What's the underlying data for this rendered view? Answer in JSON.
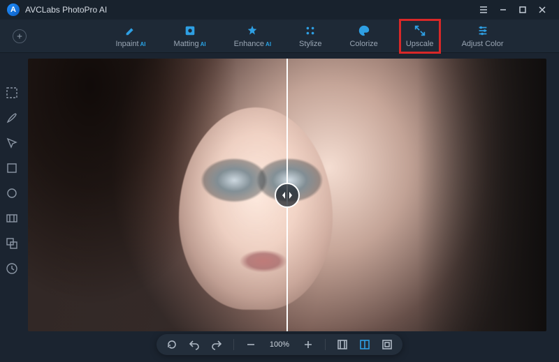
{
  "app": {
    "title": "AVCLabs PhotoPro AI"
  },
  "tabs": [
    {
      "id": "inpaint",
      "label": "Inpaint",
      "ai": "AI"
    },
    {
      "id": "matting",
      "label": "Matting",
      "ai": "AI"
    },
    {
      "id": "enhance",
      "label": "Enhance",
      "ai": "AI"
    },
    {
      "id": "stylize",
      "label": "Stylize",
      "ai": ""
    },
    {
      "id": "colorize",
      "label": "Colorize",
      "ai": ""
    },
    {
      "id": "upscale",
      "label": "Upscale",
      "ai": ""
    },
    {
      "id": "adjust",
      "label": "Adjust Color",
      "ai": ""
    }
  ],
  "highlighted_tab": "upscale",
  "bottom": {
    "zoom_pct": "100%"
  }
}
